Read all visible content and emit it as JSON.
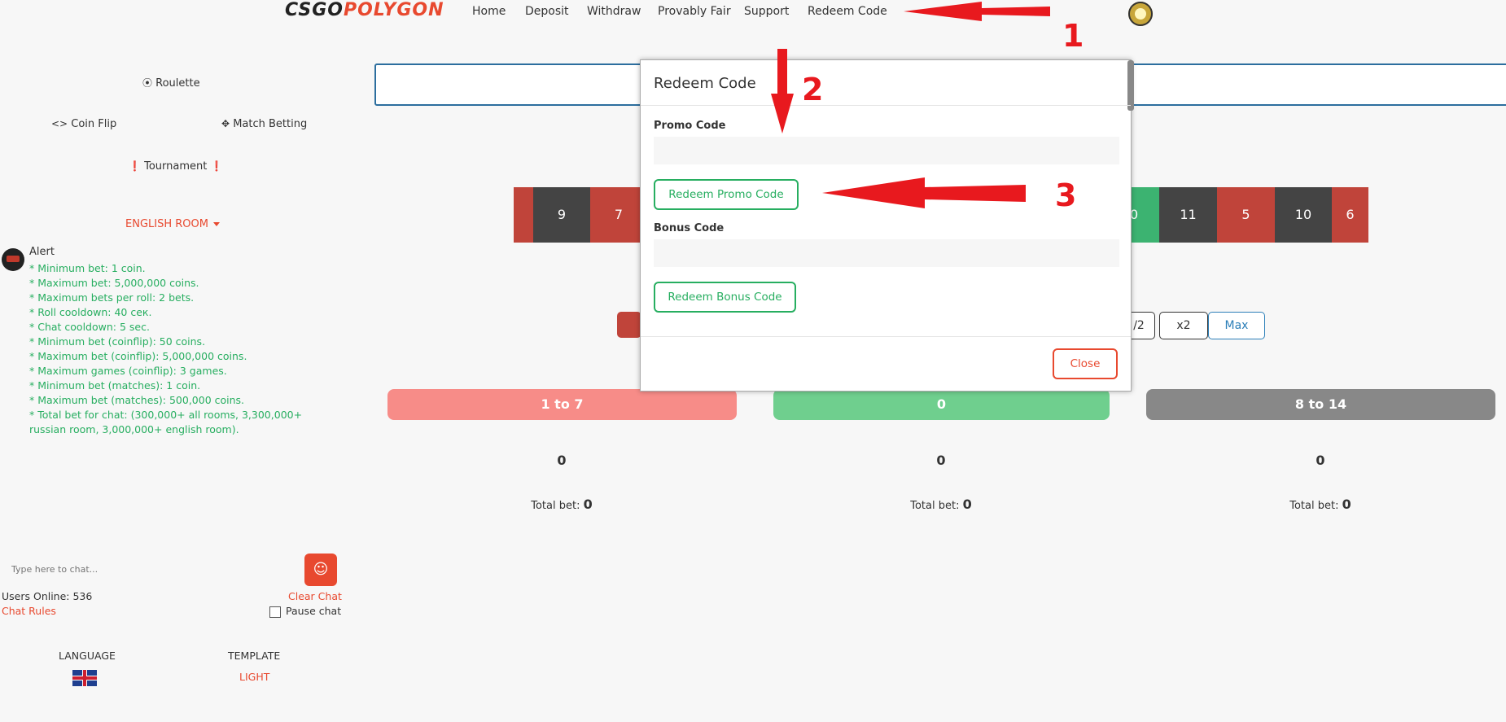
{
  "header": {
    "logo_part1": "CSGO",
    "logo_part2": "POLYGON",
    "nav": [
      "Home",
      "Deposit",
      "Withdraw",
      "Provably Fair",
      "Support",
      "Redeem Code"
    ]
  },
  "sidebar": {
    "games": {
      "roulette": "Roulette",
      "coinflip": "Coin Flip",
      "match_betting": "Match Betting",
      "tournament": "Tournament"
    },
    "room": "ENGLISH ROOM",
    "alert": {
      "title": "Alert",
      "rules": [
        "* Minimum bet: 1 coin.",
        "* Maximum bet: 5,000,000 coins.",
        "* Maximum bets per roll: 2 bets.",
        "* Roll cooldown: 40 сек.",
        "* Chat cooldown: 5 sec.",
        "* Minimum bet (coinflip): 50 coins.",
        "* Maximum bet (coinflip): 5,000,000 coins.",
        "* Maximum games (coinflip): 3 games.",
        "* Minimum bet (matches): 1 coin.",
        "* Maximum bet (matches): 500,000 coins.",
        "* Total bet for chat: (300,000+ all rooms, 3,300,000+ russian room, 3,000,000+ english room)."
      ]
    },
    "chat": {
      "placeholder": "Type here to chat...",
      "emoji": "☺",
      "users_online": "Users Online: 536",
      "chat_rules": "Chat Rules",
      "clear_chat": "Clear Chat",
      "pause_chat": "Pause chat"
    },
    "language_label": "LANGUAGE",
    "template_label": "TEMPLATE",
    "template_value": "LIGHT"
  },
  "roulette": {
    "left_numbers": [
      "9",
      "7"
    ],
    "right_numbers": [
      "0",
      "11",
      "5",
      "10",
      "6"
    ],
    "amount_buttons": [
      "/2",
      "x2",
      "Max"
    ],
    "panels": [
      {
        "label": "1 to 7",
        "count": "0",
        "total_label": "Total bet:",
        "total_value": "0"
      },
      {
        "label": "0",
        "count": "0",
        "total_label": "Total bet:",
        "total_value": "0"
      },
      {
        "label": "8 to 14",
        "count": "0",
        "total_label": "Total bet:",
        "total_value": "0"
      }
    ]
  },
  "modal": {
    "title": "Redeem Code",
    "promo_label": "Promo Code",
    "promo_button": "Redeem Promo Code",
    "bonus_label": "Bonus Code",
    "bonus_button": "Redeem Bonus Code",
    "close": "Close"
  },
  "annotations": [
    "1",
    "2",
    "3"
  ],
  "colors": {
    "accent": "#e8492f",
    "green": "#27ae60",
    "red_slot": "#c0443a",
    "dark_slot": "#444444",
    "annotation_red": "#e8191e"
  }
}
